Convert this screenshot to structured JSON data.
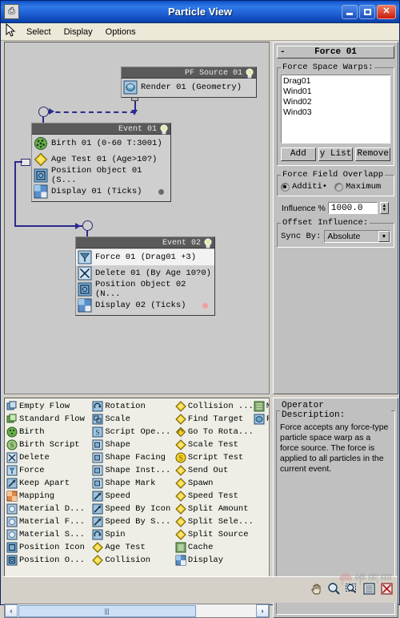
{
  "window": {
    "title": "Particle View",
    "sysmenu_icon": "system-menu-icon",
    "minimize_label": "Minimize",
    "maximize_label": "Maximize",
    "close_label": "Close"
  },
  "menubar": {
    "items": [
      {
        "label": "Select"
      },
      {
        "label": "Display"
      },
      {
        "label": "Options"
      }
    ]
  },
  "canvas": {
    "nodes": [
      {
        "title": "PF Source 01",
        "rows": [
          {
            "label": "Render 01  (Geometry)",
            "icon": "render-icon",
            "selected": false
          }
        ]
      },
      {
        "title": "Event 01",
        "rows": [
          {
            "label": "Birth 01  (0-60 T:3001)",
            "icon": "birth-icon",
            "selected": false
          },
          {
            "label": "Age Test 01  (Age>10?)",
            "icon": "age-test-icon",
            "selected": false
          },
          {
            "label": "Position Object 01  (S...",
            "icon": "position-object-icon",
            "selected": false
          },
          {
            "label": "Display 01  (Ticks)",
            "icon": "display-icon",
            "selected": false,
            "swatch": "gray"
          }
        ]
      },
      {
        "title": "Event 02",
        "rows": [
          {
            "label": "Force 01  (Drag01 +3)",
            "icon": "force-icon",
            "selected": true
          },
          {
            "label": "Delete 01  (By Age 10?0)",
            "icon": "delete-icon",
            "selected": false
          },
          {
            "label": "Position Object 02  (N...",
            "icon": "position-object-icon",
            "selected": false
          },
          {
            "label": "Display 02  (Ticks)",
            "icon": "display-icon",
            "selected": false,
            "swatch": "pink"
          }
        ]
      }
    ]
  },
  "rightpanel": {
    "rollout_title": "Force 01",
    "rollout_toggle": "-",
    "force_space_warps": {
      "legend": "Force Space Warps:",
      "items": [
        "Drag01",
        "Wind01",
        "Wind02",
        "Wind03"
      ],
      "buttons": [
        {
          "label": "Add"
        },
        {
          "label": "y List"
        },
        {
          "label": "Remove"
        }
      ]
    },
    "force_field_overlap": {
      "legend": "Force Field Overlapp",
      "options": [
        {
          "label": "Additi•",
          "selected": true
        },
        {
          "label": "Maximum",
          "selected": false
        }
      ]
    },
    "influence": {
      "label": "Influence %",
      "value": "1000.0"
    },
    "offset_influence": {
      "legend": "Offset Influence:",
      "sync_by_label": "Sync By:",
      "sync_by_value": "Absolute"
    }
  },
  "depot": {
    "columns": [
      {
        "items": [
          {
            "label": "Empty Flow",
            "icon": "flow-icon"
          },
          {
            "label": "Standard Flow",
            "icon": "flow-icon"
          },
          {
            "label": "Birth",
            "icon": "birth-icon"
          },
          {
            "label": "Birth Script",
            "icon": "birth-script-icon"
          },
          {
            "label": "Delete",
            "icon": "delete-icon"
          },
          {
            "label": "Force",
            "icon": "force-icon"
          },
          {
            "label": "Keep Apart",
            "icon": "keep-apart-icon"
          },
          {
            "label": "Mapping",
            "icon": "mapping-icon"
          },
          {
            "label": "Material D...",
            "icon": "material-icon"
          },
          {
            "label": "Material F...",
            "icon": "material-icon"
          },
          {
            "label": "Material S...",
            "icon": "material-icon"
          },
          {
            "label": "Position Icon",
            "icon": "position-icon"
          },
          {
            "label": "Position O...",
            "icon": "position-object-icon"
          }
        ]
      },
      {
        "items": [
          {
            "label": "Rotation",
            "icon": "rotation-icon"
          },
          {
            "label": "Scale",
            "icon": "scale-icon"
          },
          {
            "label": "Script Ope...",
            "icon": "script-operator-icon"
          },
          {
            "label": "Shape",
            "icon": "shape-icon"
          },
          {
            "label": "Shape Facing",
            "icon": "shape-facing-icon"
          },
          {
            "label": "Shape Inst...",
            "icon": "shape-instance-icon"
          },
          {
            "label": "Shape Mark",
            "icon": "shape-mark-icon"
          },
          {
            "label": "Speed",
            "icon": "speed-icon"
          },
          {
            "label": "Speed By Icon",
            "icon": "speed-by-icon-icon"
          },
          {
            "label": "Speed By S...",
            "icon": "speed-by-surface-icon"
          },
          {
            "label": "Spin",
            "icon": "spin-icon"
          },
          {
            "label": "Age Test",
            "icon": "age-test-icon"
          },
          {
            "label": "Collision",
            "icon": "collision-icon"
          }
        ]
      },
      {
        "items": [
          {
            "label": "Collision ...",
            "icon": "collision-spawn-icon"
          },
          {
            "label": "Find Target",
            "icon": "find-target-icon"
          },
          {
            "label": "Go To Rota...",
            "icon": "go-to-rotation-icon"
          },
          {
            "label": "Scale Test",
            "icon": "scale-test-icon"
          },
          {
            "label": "Script Test",
            "icon": "script-test-icon"
          },
          {
            "label": "Send Out",
            "icon": "send-out-icon"
          },
          {
            "label": "Spawn",
            "icon": "spawn-icon"
          },
          {
            "label": "Speed Test",
            "icon": "speed-test-icon"
          },
          {
            "label": "Split Amount",
            "icon": "split-amount-icon"
          },
          {
            "label": "Split Sele...",
            "icon": "split-selected-icon"
          },
          {
            "label": "Split Source",
            "icon": "split-source-icon"
          },
          {
            "label": "Cache",
            "icon": "cache-icon"
          },
          {
            "label": "Display",
            "icon": "display-icon"
          }
        ]
      },
      {
        "items": [
          {
            "label": "M",
            "icon": "cache-icon"
          },
          {
            "label": "F",
            "icon": "render-icon"
          }
        ]
      }
    ],
    "scrollbar": {
      "left_label": "‹",
      "right_label": "›"
    }
  },
  "description": {
    "legend": "Operator Description:",
    "text": "Force accepts any force-type particle space warp as a force source. The force is applied to all particles in the current event."
  },
  "bottombar": {
    "tools": [
      {
        "name": "pan-hand-icon"
      },
      {
        "name": "zoom-magnifier-icon"
      },
      {
        "name": "zoom-region-icon"
      },
      {
        "name": "zoom-extents-icon"
      },
      {
        "name": "zoom-extents-selected-icon"
      }
    ],
    "watermark": "维库网"
  },
  "colors": {
    "titlebar_blue": "#1f63d6",
    "canvas_bg": "#c9c9c9",
    "node_header": "#5a5a5a",
    "node_body": "#cfcfcf",
    "wire_blue": "#2a2a8e",
    "panel_gray": "#c0c0c0",
    "depot_bg": "#eeeee6",
    "birth_green": "#6ab04c",
    "test_yellow": "#f2d024",
    "operator_blue": "#5b8fc9"
  }
}
